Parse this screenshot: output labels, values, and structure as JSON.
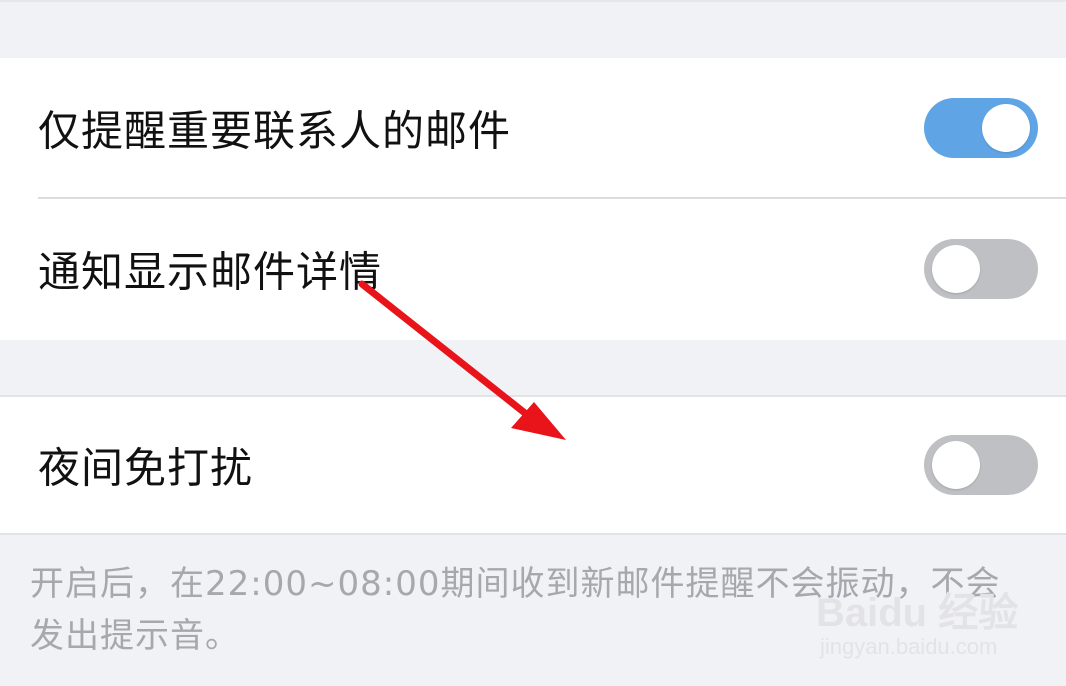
{
  "settings": {
    "important_only": {
      "label": "仅提醒重要联系人的邮件",
      "enabled": true
    },
    "show_details": {
      "label": "通知显示邮件详情",
      "enabled": false
    },
    "night_dnd": {
      "label": "夜间免打扰",
      "enabled": false
    }
  },
  "night_dnd_note": "开启后，在22:00~08:00期间收到新邮件提醒不会振动，不会发出提示音。",
  "watermark": {
    "brand": "Baidu 经验",
    "url": "jingyan.baidu.com"
  },
  "annotation": {
    "arrow_color": "#e8141a"
  },
  "colors": {
    "toggle_on": "#5fa5e6",
    "toggle_off": "#bfc0c3",
    "background": "#f1f2f6"
  }
}
